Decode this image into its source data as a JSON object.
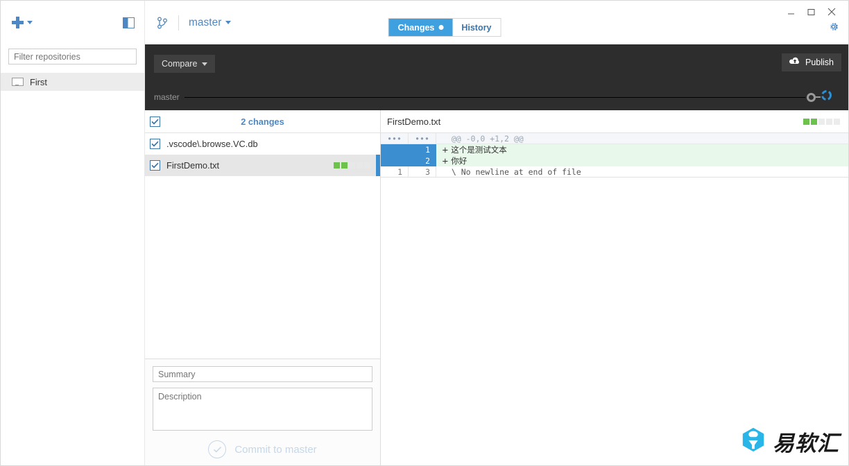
{
  "window": {
    "minimize_label": "–",
    "maximize_label": "□",
    "close_label": "×"
  },
  "sidebar": {
    "add_repo_icon": "plus-icon",
    "add_repo_caret": "chevron-down-icon",
    "toggle_icon": "sidebar-toggle-icon",
    "filter_placeholder": "Filter repositories",
    "filter_value": "",
    "repositories": [
      {
        "name": "First",
        "icon": "monitor-icon",
        "selected": true
      }
    ]
  },
  "header": {
    "branch_icon": "git-branch-icon",
    "branch_name": "master",
    "gear_icon": "gear-icon",
    "tabs": [
      {
        "label": "Changes",
        "active": true,
        "has_dot": true
      },
      {
        "label": "History",
        "active": false,
        "has_dot": false
      }
    ]
  },
  "toolbar": {
    "compare_label": "Compare",
    "compare_caret": "chevron-down-icon",
    "publish_label": "Publish",
    "publish_icon": "cloud-upload-icon",
    "timeline_branch_label": "master"
  },
  "changes": {
    "header_label": "2 changes",
    "header_checked": true,
    "files": [
      {
        "name": ".vscode\\.browse.VC.db",
        "checked": true,
        "selected": false,
        "stats": []
      },
      {
        "name": "FirstDemo.txt",
        "checked": true,
        "selected": true,
        "stats": [
          "added",
          "added",
          "empty",
          "empty",
          "empty"
        ]
      }
    ]
  },
  "commit": {
    "summary_placeholder": "Summary",
    "summary_value": "",
    "description_placeholder": "Description",
    "description_value": "",
    "commit_button_label": "Commit to master",
    "commit_button_icon": "check-circle-icon",
    "commit_button_enabled": false
  },
  "diff": {
    "filename": "FirstDemo.txt",
    "stats": [
      "added",
      "added",
      "empty",
      "empty",
      "empty"
    ],
    "lines": [
      {
        "old": "•••",
        "new": "•••",
        "text": "  @@ -0,0 +1,2 @@",
        "type": "hunk"
      },
      {
        "old": "",
        "new": "1",
        "text": "+ 这个是测试文本",
        "type": "added"
      },
      {
        "old": "",
        "new": "2",
        "text": "+ 你好",
        "type": "added"
      },
      {
        "old": "1",
        "new": "3",
        "text": "  \\ No newline at end of file",
        "type": "nonewline"
      }
    ]
  },
  "watermark": {
    "text": "易软汇",
    "logo_icon": "hexagon-logo-icon"
  },
  "colors": {
    "accent_blue": "#3fa0df",
    "link_blue": "#4d88c4",
    "added_green": "#6dc24b",
    "dark_bar": "#2d2d2d",
    "diff_added_bg": "#e8f8ea"
  }
}
